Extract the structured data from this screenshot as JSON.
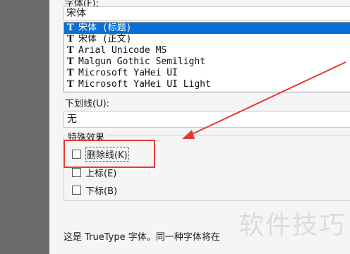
{
  "font_section": {
    "label": "字体(F):",
    "current_value": "宋体",
    "items": [
      {
        "label": "宋体 (标题)",
        "selected": true
      },
      {
        "label": "宋体 (正文)",
        "selected": false
      },
      {
        "label": "Arial Unicode MS",
        "selected": false
      },
      {
        "label": "Malgun Gothic Semilight",
        "selected": false
      },
      {
        "label": "Microsoft YaHei UI",
        "selected": false
      },
      {
        "label": "Microsoft YaHei UI Light",
        "selected": false
      }
    ]
  },
  "underline": {
    "label": "下划线(U):",
    "value": "无"
  },
  "effects": {
    "title": "特殊效果",
    "strikethrough": {
      "label": "删除线(K)",
      "checked": false
    },
    "superscript": {
      "label": "上标(E)",
      "checked": false
    },
    "subscript": {
      "label": "下标(B)",
      "checked": false
    }
  },
  "note": "这是 TrueType 字体。同一种字体将在",
  "watermark": "软件技巧",
  "colors": {
    "selection": "#0a6fd6",
    "highlight": "#e53b2f",
    "arrow": "#e53b2f"
  }
}
